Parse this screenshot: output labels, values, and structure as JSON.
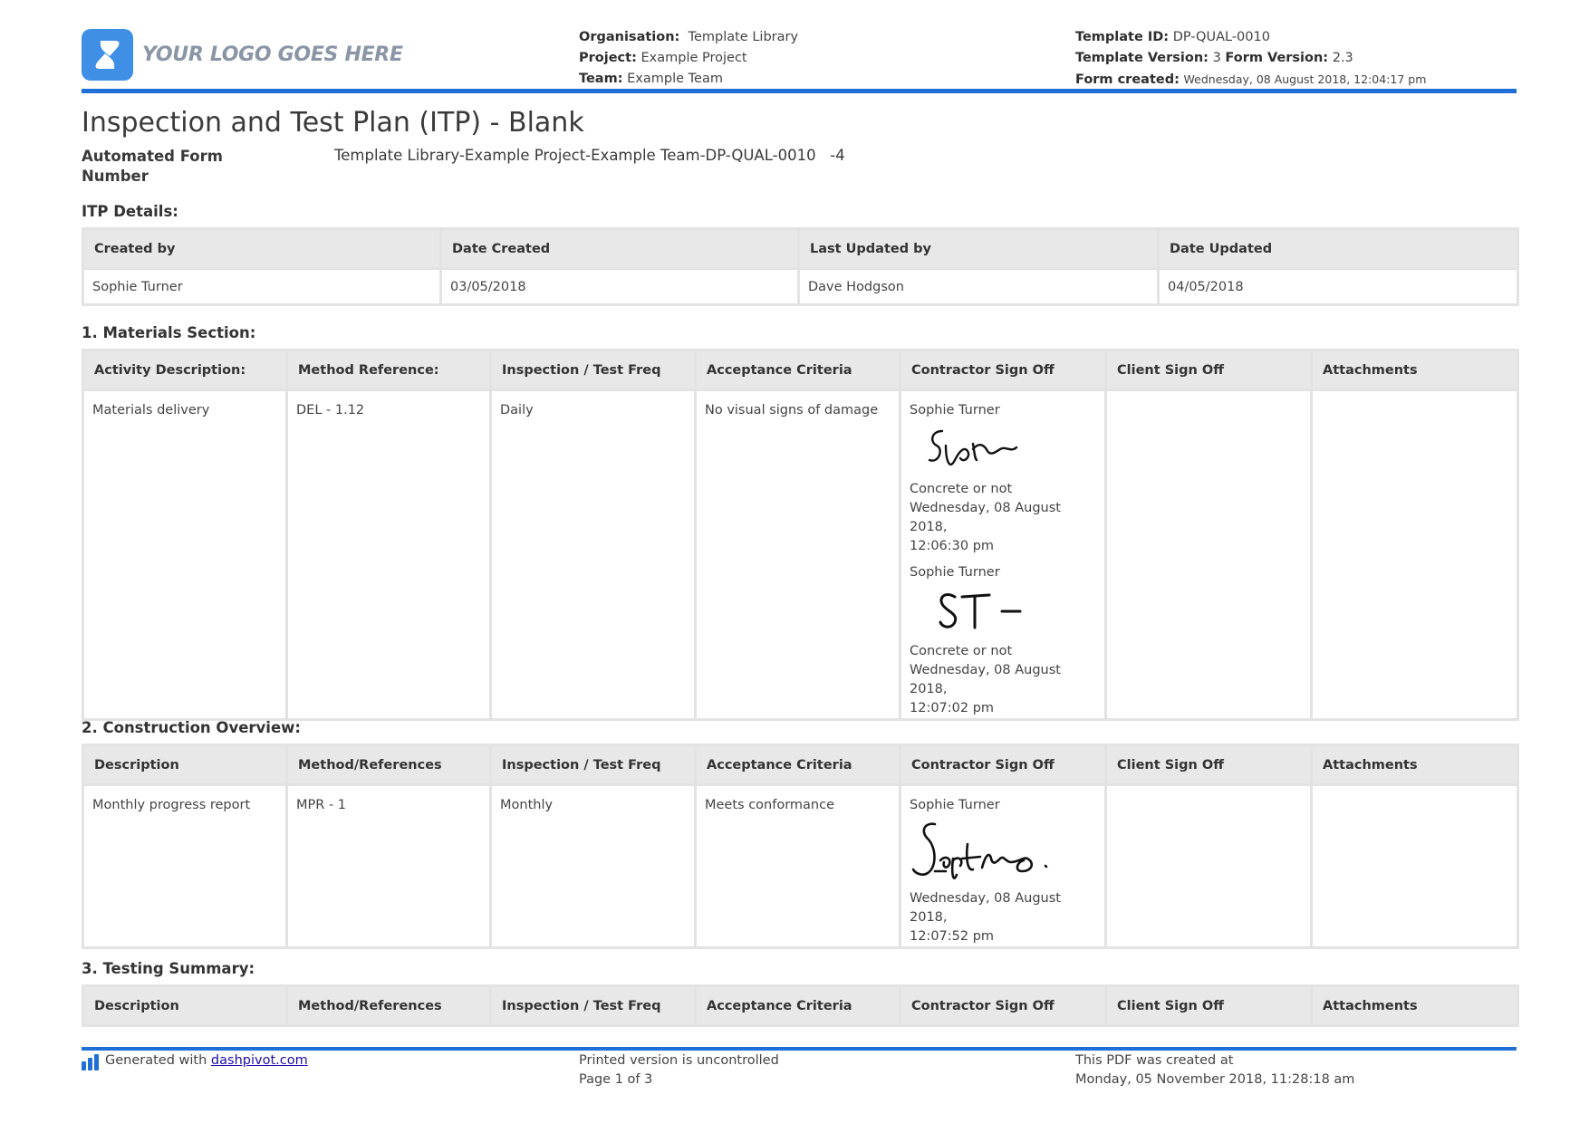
{
  "header": {
    "logo_text": "YOUR LOGO GOES HERE",
    "organisation_label": "Organisation:",
    "organisation": "Template Library",
    "project_label": "Project:",
    "project": "Example Project",
    "team_label": "Team:",
    "team": "Example Team",
    "template_id_label": "Template ID:",
    "template_id": "DP-QUAL-0010",
    "template_version_label": "Template Version:",
    "template_version": "3",
    "form_version_label": "Form Version:",
    "form_version": "2.3",
    "form_created_label": "Form created:",
    "form_created": "Wednesday, 08 August 2018, 12:04:17 pm"
  },
  "title": "Inspection and Test Plan (ITP) - Blank",
  "automated_form_number": {
    "label": "Automated Form Number",
    "value": "Template Library-Example Project-Example Team-DP-QUAL-0010   -4"
  },
  "itp_details": {
    "title": "ITP Details:",
    "headers": [
      "Created by",
      "Date Created",
      "Last Updated by",
      "Date Updated"
    ],
    "row": [
      "Sophie Turner",
      "03/05/2018",
      "Dave Hodgson",
      "04/05/2018"
    ]
  },
  "materials": {
    "title": "1. Materials Section:",
    "headers": [
      "Activity Description:",
      "Method Reference:",
      "Inspection / Test Freq",
      "Acceptance Criteria",
      "Contractor Sign Off",
      "Client Sign Off",
      "Attachments"
    ],
    "row": {
      "activity": "Materials delivery",
      "method": "DEL - 1.12",
      "freq": "Daily",
      "criteria": "No visual signs of damage",
      "signoffs": [
        {
          "name": "Sophie Turner",
          "note": "Concrete or not",
          "date": "Wednesday, 08 August 2018,",
          "time": "12:06:30 pm"
        },
        {
          "name": "Sophie Turner",
          "note": "Concrete or not",
          "date": "Wednesday, 08 August 2018,",
          "time": "12:07:02 pm"
        }
      ]
    }
  },
  "construction": {
    "title": "2. Construction Overview:",
    "headers": [
      "Description",
      "Method/References",
      "Inspection / Test Freq",
      "Acceptance Criteria",
      "Contractor Sign Off",
      "Client Sign Off",
      "Attachments"
    ],
    "row": {
      "description": "Monthly progress report",
      "method": "MPR - 1",
      "freq": "Monthly",
      "criteria": "Meets conformance",
      "signoff": {
        "name": "Sophie Turner",
        "date": "Wednesday, 08 August 2018,",
        "time": "12:07:52 pm"
      }
    }
  },
  "testing": {
    "title": "3. Testing Summary:",
    "headers": [
      "Description",
      "Method/References",
      "Inspection / Test Freq",
      "Acceptance Criteria",
      "Contractor Sign Off",
      "Client Sign Off",
      "Attachments"
    ]
  },
  "footer": {
    "generated_prefix": "Generated with",
    "generated_link": "dashpivot.com",
    "uncontrolled": "Printed version is uncontrolled",
    "page": "Page 1 of 3",
    "pdf_created_label": "This PDF was created at",
    "pdf_created": "Monday, 05 November 2018, 11:28:18 am"
  },
  "colors": {
    "accent": "#1f6fd6",
    "logo": "#3f8fe6",
    "header_fill": "#e8e8e8",
    "border": "#e3e3e3"
  }
}
